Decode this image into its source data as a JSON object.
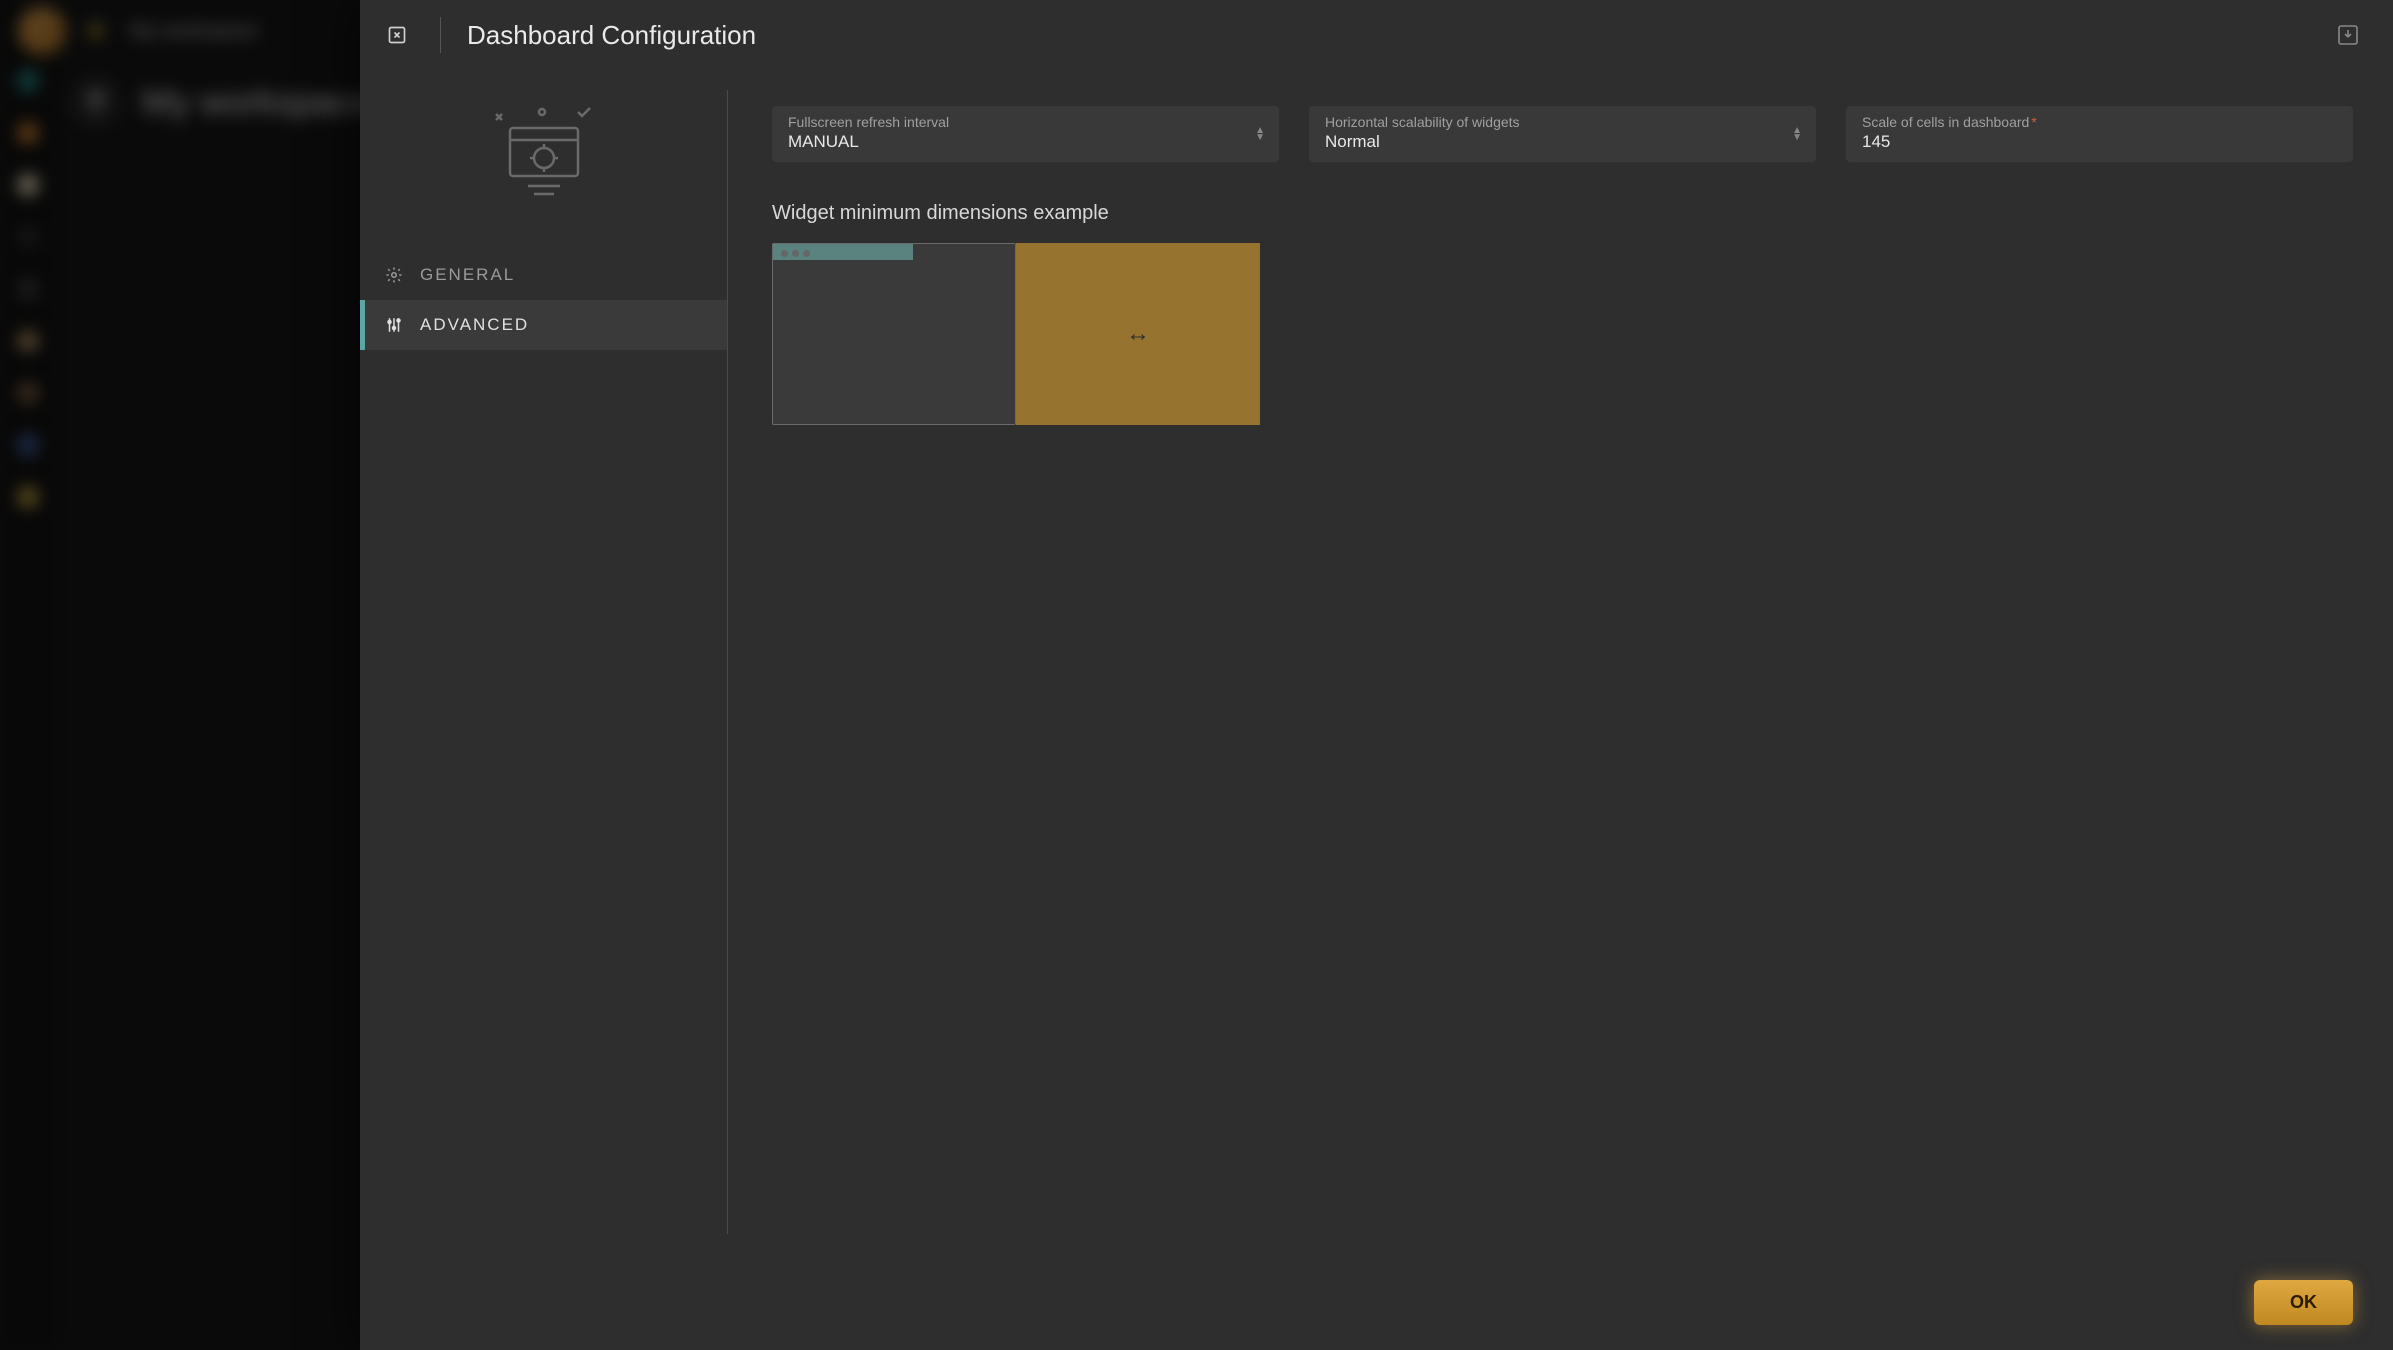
{
  "background": {
    "workspace_label": "My workspace",
    "title": "My workspace"
  },
  "modal": {
    "title": "Dashboard Configuration",
    "nav": {
      "general": "General",
      "advanced": "Advanced"
    },
    "fields": {
      "refresh": {
        "label": "Fullscreen refresh interval",
        "value": "MANUAL"
      },
      "scalability": {
        "label": "Horizontal scalability of widgets",
        "value": "Normal"
      },
      "scale": {
        "label": "Scale of cells in dashboard",
        "value": "145",
        "required": "*"
      }
    },
    "section_title": "Widget minimum dimensions example",
    "ok": "OK"
  }
}
